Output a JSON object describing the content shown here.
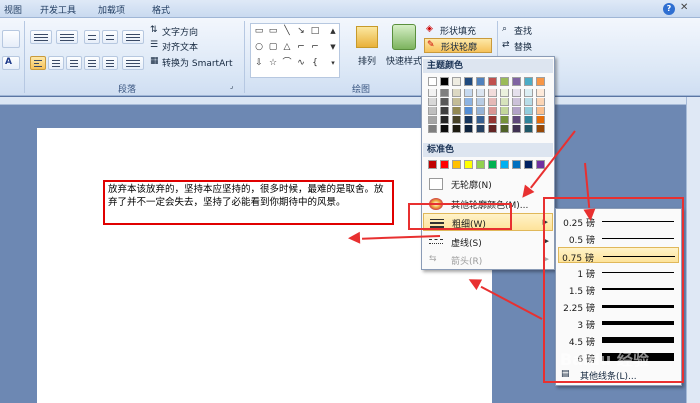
{
  "tabs": [
    {
      "label": "视图"
    },
    {
      "label": "开发工具"
    },
    {
      "label": "加载项"
    },
    {
      "label": "格式"
    }
  ],
  "help_icon": "question-icon",
  "ribbon": {
    "paragraph": {
      "text_direction": "文字方向",
      "align_text": "对齐文本",
      "convert_smartart": "转换为 SmartArt",
      "group_label": "段落"
    },
    "drawing": {
      "arrange": "排列",
      "quick_styles": "快速样式",
      "group_label": "绘图"
    },
    "shape_fill": "形状填充",
    "shape_outline": "形状轮廓",
    "find": "查找",
    "replace": "替换"
  },
  "document": {
    "text": "放弃本该放弃的，坚持本应坚持的，很多时候，最难的是取舍。放弃了并不一定会失去，坚持了必能看到你期待中的风景。"
  },
  "outline_menu": {
    "theme_colors_header": "主题颜色",
    "standard_colors_header": "标准色",
    "no_outline": "无轮廓(N)",
    "more_colors": "其他轮廓颜色(M)...",
    "weight": "粗细(W)",
    "dashes": "虚线(S)",
    "arrows": "箭头(R)",
    "theme_top_row": [
      "#ffffff",
      "#000000",
      "#eeece1",
      "#1f497d",
      "#4f81bd",
      "#c0504d",
      "#9bbb59",
      "#8064a2",
      "#4bacc6",
      "#f79646"
    ],
    "theme_shades": [
      [
        "#f2f2f2",
        "#7f7f7f",
        "#ddd9c3",
        "#c6d9f0",
        "#dbe5f1",
        "#f2dcdb",
        "#ebf1dd",
        "#e5e0ec",
        "#dbeef3",
        "#fdeada"
      ],
      [
        "#d8d8d8",
        "#595959",
        "#c4bd97",
        "#8db3e2",
        "#b8cce4",
        "#e5b9b7",
        "#d7e3bc",
        "#ccc1d9",
        "#b7dde8",
        "#fbd5b5"
      ],
      [
        "#bfbfbf",
        "#3f3f3f",
        "#938953",
        "#548dd4",
        "#95b3d7",
        "#d99694",
        "#c3d69b",
        "#b2a2c7",
        "#92cddc",
        "#fac08f"
      ],
      [
        "#a5a5a5",
        "#262626",
        "#494429",
        "#17365d",
        "#366092",
        "#953734",
        "#76923c",
        "#5f497a",
        "#31859b",
        "#e36c09"
      ],
      [
        "#7f7f7f",
        "#0c0c0c",
        "#1d1b10",
        "#0f243e",
        "#244061",
        "#632423",
        "#4f6128",
        "#3f3151",
        "#205867",
        "#974806"
      ]
    ],
    "standard_colors": [
      "#c00000",
      "#ff0000",
      "#ffc000",
      "#ffff00",
      "#92d050",
      "#00b050",
      "#00b0f0",
      "#0070c0",
      "#002060",
      "#7030a0"
    ]
  },
  "weight_menu": {
    "items": [
      {
        "label": "0.25 磅",
        "weight": 0.25
      },
      {
        "label": "0.5 磅",
        "weight": 0.5
      },
      {
        "label": "0.75 磅",
        "weight": 0.75,
        "selected": true
      },
      {
        "label": "1 磅",
        "weight": 1
      },
      {
        "label": "1.5 磅",
        "weight": 1.5
      },
      {
        "label": "2.25 磅",
        "weight": 2.25
      },
      {
        "label": "3 磅",
        "weight": 3
      },
      {
        "label": "4.5 磅",
        "weight": 4.5
      },
      {
        "label": "6 磅",
        "weight": 6
      }
    ],
    "more_lines": "其他线条(L)..."
  },
  "annotation_color": "#e83030"
}
